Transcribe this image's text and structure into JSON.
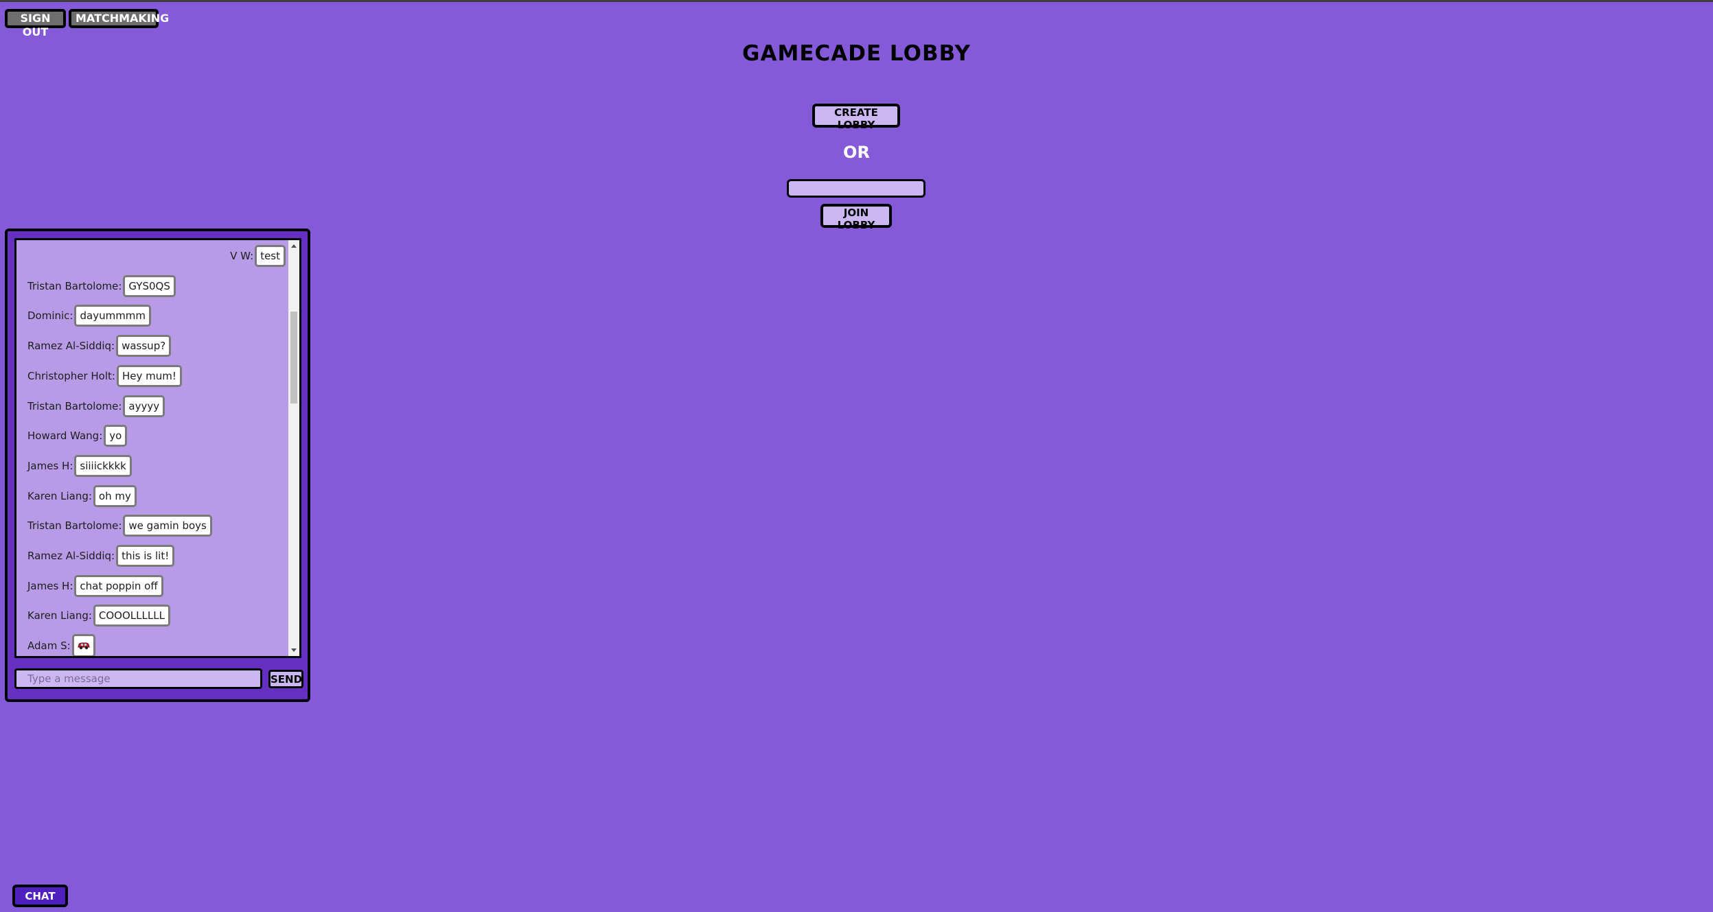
{
  "header": {
    "sign_out_label": "SIGN OUT",
    "matchmaking_label": "MATCHMAKING"
  },
  "main": {
    "title": "GAMECADE LOBBY",
    "create_lobby_label": "CREATE LOBBY",
    "or_label": "OR",
    "lobby_code_value": "",
    "join_lobby_label": "JOIN LOBBY"
  },
  "chat": {
    "messages": [
      {
        "author": "V W:",
        "text": "test",
        "align": "right"
      },
      {
        "author": "Tristan Bartolome:",
        "text": "GYS0QS"
      },
      {
        "author": "Dominic:",
        "text": "dayummmm"
      },
      {
        "author": "Ramez Al-Siddiq:",
        "text": "wassup?"
      },
      {
        "author": "Christopher Holt:",
        "text": "Hey mum!"
      },
      {
        "author": "Tristan Bartolome:",
        "text": "ayyyy"
      },
      {
        "author": "Howard Wang:",
        "text": "yo"
      },
      {
        "author": "James H:",
        "text": "siiiickkkk"
      },
      {
        "author": "Karen Liang:",
        "text": "oh my"
      },
      {
        "author": "Tristan Bartolome:",
        "text": "we gamin boys"
      },
      {
        "author": "Ramez Al-Siddiq:",
        "text": "this is lit!"
      },
      {
        "author": "James H:",
        "text": "chat poppin off"
      },
      {
        "author": "Karen Liang:",
        "text": "COOOLLLLLL"
      },
      {
        "author": "Adam S:",
        "text": "",
        "icon": "red-car-emoji-icon"
      }
    ],
    "input_placeholder": "Type a message",
    "input_value": "",
    "send_label": "SEND",
    "toggle_label": "CHAT"
  }
}
